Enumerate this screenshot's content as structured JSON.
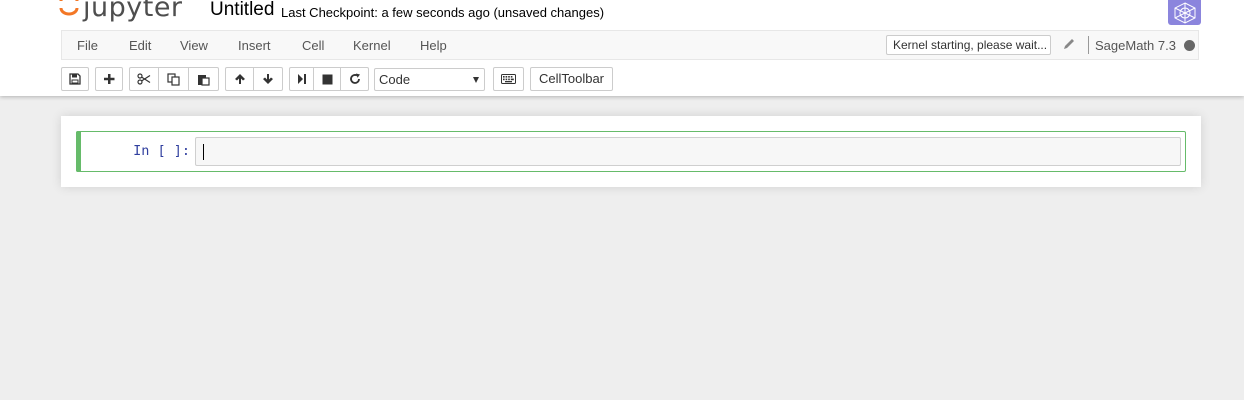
{
  "header": {
    "logo_text": "jupyter",
    "notebook_name": "Untitled",
    "checkpoint_text": "Last Checkpoint: a few seconds ago (unsaved changes)",
    "kernel_logo_icon": "sagemath-logo-icon"
  },
  "menubar": {
    "items": [
      {
        "label": "File"
      },
      {
        "label": "Edit"
      },
      {
        "label": "View"
      },
      {
        "label": "Insert"
      },
      {
        "label": "Cell"
      },
      {
        "label": "Kernel"
      },
      {
        "label": "Help"
      }
    ],
    "kernel_status": "Kernel starting, please wait...",
    "kernel_name": "SageMath 7.3"
  },
  "toolbar": {
    "cell_type": "Code",
    "celltoolbar_label": "CellToolbar",
    "icons": [
      "save-icon",
      "plus-icon",
      "cut-icon",
      "copy-icon",
      "paste-icon",
      "arrow-up-icon",
      "arrow-down-icon",
      "run-icon",
      "stop-icon",
      "restart-icon",
      "keyboard-icon"
    ]
  },
  "cell": {
    "prompt": "In [ ]:",
    "source": ""
  },
  "colors": {
    "accent_green": "#66bb6a",
    "prompt_blue": "#303f9f",
    "kernel_logo_bg": "#8b85dd",
    "page_bg": "#eeeeee"
  }
}
